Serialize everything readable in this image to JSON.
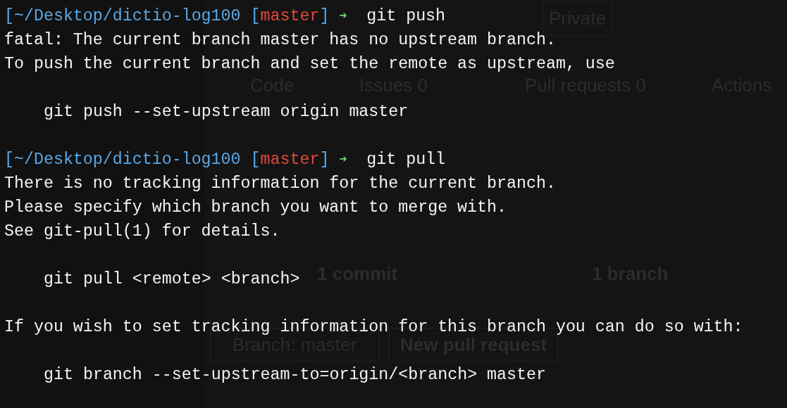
{
  "background_window": {
    "visibility": "Private",
    "tabs": [
      {
        "label": "Code"
      },
      {
        "label": "Issues",
        "count": "0"
      },
      {
        "label": "Pull requests",
        "count": "0"
      },
      {
        "label": "Actions"
      }
    ],
    "stats": [
      "1 commit",
      "1 branch"
    ],
    "branch_button": "Branch: master",
    "new_pull_request_button": "New pull request"
  },
  "terminal": {
    "lines": [
      {
        "kind": "prompt",
        "path": "[~/Desktop/dictio-log100",
        "bracket_open": "[",
        "branch": "master",
        "bracket_close": "]",
        "arrow": "➜",
        "command": "git push"
      },
      {
        "kind": "output",
        "text": "fatal: The current branch master has no upstream branch."
      },
      {
        "kind": "output",
        "text": "To push the current branch and set the remote as upstream, use"
      },
      {
        "kind": "blank"
      },
      {
        "kind": "output",
        "indented": true,
        "text": "git push --set-upstream origin master"
      },
      {
        "kind": "blank"
      },
      {
        "kind": "prompt",
        "path": "[~/Desktop/dictio-log100",
        "bracket_open": "[",
        "branch": "master",
        "bracket_close": "]",
        "arrow": "➜",
        "command": "git pull"
      },
      {
        "kind": "output",
        "text": "There is no tracking information for the current branch."
      },
      {
        "kind": "output",
        "text": "Please specify which branch you want to merge with."
      },
      {
        "kind": "output",
        "text": "See git-pull(1) for details."
      },
      {
        "kind": "blank"
      },
      {
        "kind": "output",
        "indented": true,
        "text": "git pull <remote> <branch>"
      },
      {
        "kind": "blank"
      },
      {
        "kind": "output",
        "text": "If you wish to set tracking information for this branch you can do so with:"
      },
      {
        "kind": "blank"
      },
      {
        "kind": "output",
        "indented": true,
        "text": "git branch --set-upstream-to=origin/<branch> master"
      }
    ]
  }
}
